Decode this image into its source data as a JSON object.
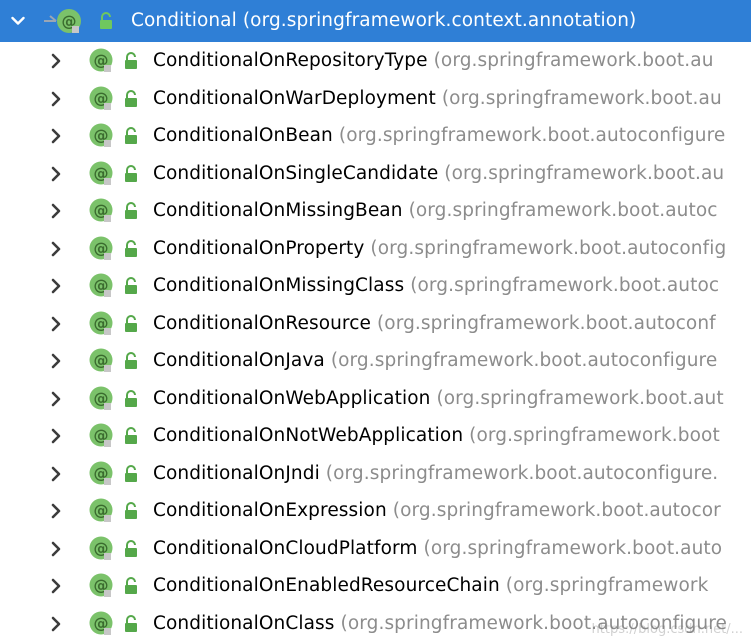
{
  "tree": {
    "root": {
      "name": "Conditional",
      "package": "(org.springframework.context.annotation)",
      "expanded": true,
      "icons": [
        "chevron-down-icon",
        "annotation-icon",
        "lock-icon"
      ]
    },
    "items": [
      {
        "name": "ConditionalOnRepositoryType",
        "package": "(org.springframework.boot.au"
      },
      {
        "name": "ConditionalOnWarDeployment",
        "package": "(org.springframework.boot.au"
      },
      {
        "name": "ConditionalOnBean",
        "package": "(org.springframework.boot.autoconfigure"
      },
      {
        "name": "ConditionalOnSingleCandidate",
        "package": "(org.springframework.boot.au"
      },
      {
        "name": "ConditionalOnMissingBean",
        "package": "(org.springframework.boot.autoc"
      },
      {
        "name": "ConditionalOnProperty",
        "package": "(org.springframework.boot.autoconfig"
      },
      {
        "name": "ConditionalOnMissingClass",
        "package": "(org.springframework.boot.autoc"
      },
      {
        "name": "ConditionalOnResource",
        "package": "(org.springframework.boot.autoconf"
      },
      {
        "name": "ConditionalOnJava",
        "package": "(org.springframework.boot.autoconfigure"
      },
      {
        "name": "ConditionalOnWebApplication",
        "package": "(org.springframework.boot.aut"
      },
      {
        "name": "ConditionalOnNotWebApplication",
        "package": "(org.springframework.boot"
      },
      {
        "name": "ConditionalOnJndi",
        "package": "(org.springframework.boot.autoconfigure."
      },
      {
        "name": "ConditionalOnExpression",
        "package": "(org.springframework.boot.autocor"
      },
      {
        "name": "ConditionalOnCloudPlatform",
        "package": "(org.springframework.boot.auto"
      },
      {
        "name": "ConditionalOnEnabledResourceChain",
        "package": "(org.springframework"
      },
      {
        "name": "ConditionalOnClass",
        "package": "(org.springframework.boot.autoconfigure"
      }
    ],
    "item_icons": [
      "chevron-right-icon",
      "annotation-icon",
      "lock-icon"
    ]
  },
  "colors": {
    "selection": "#2f7fd6",
    "annotation_green": "#7bc26a",
    "lock_green": "#55a84a",
    "package_gray": "#8c8c8c"
  },
  "watermark": "https://blog.csdn.net/..."
}
